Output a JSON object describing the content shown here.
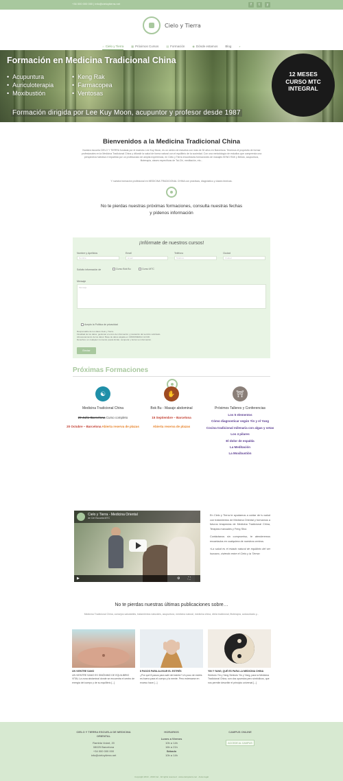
{
  "topbar": {
    "contact": "+34 000 000 000   |   info@cieloytierra.net",
    "social": [
      "f",
      "t",
      "y"
    ]
  },
  "brand": {
    "name": "Cielo y Tierra"
  },
  "nav": [
    {
      "icon": "⌂",
      "label": "Cielo y Tierra",
      "active": true
    },
    {
      "icon": "▦",
      "label": "Próximos Cursos",
      "active": false
    },
    {
      "icon": "▤",
      "label": "Formación",
      "active": false
    },
    {
      "icon": "◉",
      "label": "Dónde estamos",
      "active": false
    },
    {
      "icon": "",
      "label": "Blog",
      "active": false
    },
    {
      "icon": "⌕",
      "label": "",
      "active": false
    }
  ],
  "hero": {
    "title": "Formación en Medicina Tradicional China",
    "list_left": [
      "Acupuntura",
      "Auriculoterapia",
      "Moxibustión"
    ],
    "list_right": [
      "Keng Rak",
      "Farmacopea",
      "Ventosas"
    ],
    "subtitle": "Formación dirigida por Lee Kuy Moon, acupuntor y profesor desde 1987",
    "badge_line1": "12 MESES",
    "badge_line2": "CURSO MTC",
    "badge_line3": "INTEGRAL"
  },
  "welcome": {
    "title": "Bienvenidos a la Medicina Tradicional China",
    "text": "Nuestra escuela CIELO Y TIERRA fundada por el maestro Lee Kuy Moon, es un centro de estudios con más de 30 años en Barcelona. Tenemos el propósito de formar profesionales en la Medicina Tradicional China y difundir la salud de forma natural con el equilibrio de la sociedad. Con una metodología de estudios que comprenda una perspectiva holística e impartida por un profesorado de amplia experiencia, en Cielo y Tierra encontrarás formaciones de masajes KENG RAK y Bekdo, acupuntura, fitoterapia, clases específicas de Tai-Chi, meditación, etc...",
    "text2": "Y nuestra formación profesional en MEDICINA TRADICIONAL CHINA con prácticas, diagnóstico y clases teóricas."
  },
  "cta": {
    "line1": "No te pierdas nuestras próximas formaciones, consulta nuestras fechas",
    "line2": "y pídenos información"
  },
  "form": {
    "title": "¡Infórmate de nuestros cursos!",
    "fields": [
      {
        "label": "Nombre y Apellidos",
        "placeholder": "Nombre"
      },
      {
        "label": "Email",
        "placeholder": "Email"
      },
      {
        "label": "Teléfono",
        "placeholder": "Teléfono"
      },
      {
        "label": "Ciudad",
        "placeholder": "Ciudad"
      }
    ],
    "interest_label": "Solicito información de",
    "options": [
      "Curso Bok Bu",
      "Curso MTC"
    ],
    "message_label": "Mensaje",
    "message_placeholder": "Mensaje",
    "privacy": "Acepto la Política de privacidad",
    "notes": [
      "Responsable de los datos Cielo y Tierra.",
      "Finalidad de los datos: gestionar el envío de información y prestación del servicio solicitado.",
      "Almacenamiento de los datos: Base de datos alojada en CDMX/MEDIA CLOUD.",
      "Derechos: en cualquier momento puede limitar, recuperar y borrar su información."
    ],
    "submit": "Enviar"
  },
  "formaciones": {
    "title": "Próximas Formaciones",
    "cols": [
      {
        "icon": "☯",
        "title": "Medicina Tradicional China",
        "items": [
          {
            "parts": [
              {
                "t": "20 Julio Barcelona",
                "c": "strike"
              },
              {
                "t": " Curso completo",
                "c": ""
              }
            ]
          },
          {
            "parts": [
              {
                "t": "20 Octubre – Barcelona",
                "c": "red"
              },
              {
                "t": " Abierta reserva de plazas",
                "c": "orange"
              }
            ]
          }
        ]
      },
      {
        "icon": "✋",
        "title": "Bok Bu - Masaje abdominal",
        "items": [
          {
            "parts": [
              {
                "t": "15 Septiembre – Barcelona",
                "c": "red"
              }
            ]
          },
          {
            "parts": [
              {
                "t": "Abierta reserva de plazas",
                "c": "orange"
              }
            ]
          }
        ]
      },
      {
        "icon": "⛩",
        "title": "Próximos Talleres y Conferencias",
        "items": [
          {
            "parts": [
              {
                "t": "Los 5 elementos",
                "c": "purple"
              }
            ]
          },
          {
            "parts": [
              {
                "t": "Cómo diagnosticar según Yin y el Yang",
                "c": "purple"
              }
            ]
          },
          {
            "parts": [
              {
                "t": "Cocina tradicional milenaria con algas y setas",
                "c": "purple"
              }
            ]
          },
          {
            "parts": [
              {
                "t": "Los 4 pilares",
                "c": "purple"
              }
            ]
          },
          {
            "parts": [
              {
                "t": "El dolor de espalda",
                "c": "purple"
              }
            ]
          },
          {
            "parts": [
              {
                "t": "La Meditación",
                "c": "purple"
              }
            ]
          },
          {
            "parts": [
              {
                "t": "La Moxibustión",
                "c": "purple"
              }
            ]
          }
        ]
      }
    ]
  },
  "video": {
    "title": "Cielo y Tierra - Medicina Oriental",
    "subtitle": "de Cel Escuela MTC"
  },
  "video_text": {
    "p1": "En Cielo y Tierra te ayudamos a cuidar de tu salud con tratamientos de Medicina Oriental y formamos a futuros terapeutas de Medicina Tradicional China, Terapias manuales y Feng Shui.",
    "p2": "Contáctanos sin compromiso, te atenderemos encantados en cualquiera de nuestros centros.",
    "p3": "«La salud es el estado natural de equilibrio del ser humano, viviendo entre el Cielo y la Tierra»"
  },
  "blog": {
    "title": "No te pierdas nuestras últimas publicaciones sobre…",
    "categories": "Medicina Tradicional China, consejos saludables, tratamientos naturales, acupuntura, medicina natural, medicina china, dieta tradicional, fitoterapia, autocuidado y...",
    "posts": [
      {
        "title": "UN VIENTRE SANO",
        "excerpt": "UN VIENTRE SANO ES SINÓNIMO DE EQUILIBRIO VITAL La zona abdominal donde se encuentra el centro de energía del cuerpo y de su equilibrio [...]"
      },
      {
        "title": "8 PASOS PARA ALIVIAR EL ESTRÉS",
        "excerpt": "¿Por qué 8 pasos para salir del estrés? Un poco de estrés es bueno para el cuerpo y la mente. Pero estresarse en exceso hace [...]"
      },
      {
        "title": "YIN Y YANG, QUÉ ES PARA LA MEDICINA CHINA",
        "excerpt": "Símbolo Yin y Yang Símbolo Yin y Yang, para la Medicina Tradicional China, son dos opuestos pero simbólicos, que nos permite describir el principio universal [...]"
      }
    ]
  },
  "footer": {
    "col1_title": "CIELO Y TIERRA ESCUELA DE MEDICINA ORIENTAL",
    "col1_lines": [
      "Rambla Volart, 20",
      "08025 Barcelona",
      "+34 000 000 000",
      "info@cieloytierra.net"
    ],
    "col2_title": "HORARIOS",
    "col2_lines": [
      "Lunes a Viernes",
      "10h a 14h",
      "16h a 21h",
      "Sábado",
      "10h a 14h"
    ],
    "col3_title": "CAMPUS ONLINE",
    "col3_button": "ACCEDE AL CAMPUS",
    "copyright": "Copyright 2010 - 2019 Cel · All rights reserved · www.cieloytierra.net · Aviso legal"
  },
  "colors": {
    "accent": "#a8c89e",
    "footer": "#d7e9d1",
    "form": "#e8f4e4"
  }
}
